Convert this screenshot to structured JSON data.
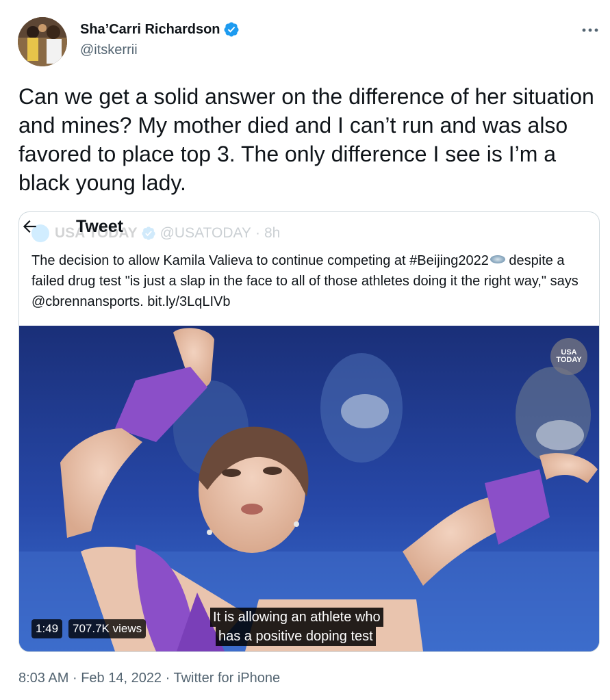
{
  "author": {
    "name": "Sha’Carri Richardson",
    "handle": "@itskerrii",
    "verified": true
  },
  "tweet": {
    "text": "Can we get a solid answer on the difference of her situation and mines? My mother died and I can’t run and was also favored to place top 3. The only difference I see is I’m a black young lady."
  },
  "nav": {
    "back_icon": "arrow-left-icon",
    "title": "Tweet"
  },
  "quoted": {
    "name": "USA TODAY",
    "handle": "@USATODAY",
    "separator": "·",
    "time": "8h",
    "text_before": "The decision to allow Kamila Valieva to continue competing at #Beijing2022",
    "text_after": "despite a failed drug test \"is just a slap in the face to all of those athletes doing it the right way,\" says @cbrennansports. bit.ly/3LqLIVb",
    "video": {
      "logo_line1": "USA",
      "logo_line2": "TODAY",
      "duration": "1:49",
      "views": "707.7K views",
      "caption_line1": "It is allowing an athlete who",
      "caption_line2": "has a positive doping test"
    }
  },
  "meta": {
    "time": "8:03 AM",
    "separator1": "·",
    "date": "Feb 14, 2022",
    "separator2": "·",
    "source": "Twitter for iPhone"
  },
  "colors": {
    "text": "#0f1419",
    "secondary": "#536471",
    "verified": "#1d9bf0",
    "border": "#cfd9de",
    "video_bg": "#1f3a8a",
    "glove": "#8b4fc8"
  }
}
